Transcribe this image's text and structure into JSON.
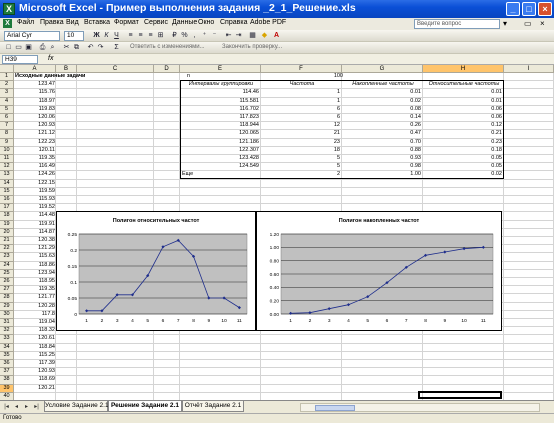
{
  "window": {
    "title": "Microsoft Excel - Пример выполнения задания _2_1_Решение.xls"
  },
  "menu": {
    "items": [
      "Файл",
      "Правка",
      "Вид",
      "Вставка",
      "Формат",
      "Сервис",
      "Данные",
      "Окно",
      "Справка",
      "Adobe PDF"
    ],
    "help_placeholder": "Введите вопрос"
  },
  "toolbar": {
    "font_name": "Arial Cyr",
    "font_size": "10",
    "currency_label": "%",
    "review_text_1": "Ответить с изменениями...",
    "review_text_2": "Закончить проверку..."
  },
  "formula_bar": {
    "name_box": "H39",
    "fx": "fx"
  },
  "columns": [
    "A",
    "B",
    "C",
    "D",
    "E",
    "F",
    "G",
    "H",
    "I"
  ],
  "selected_column": "H",
  "rows": [
    "1",
    "2",
    "3",
    "4",
    "5",
    "6",
    "7",
    "8",
    "9",
    "10",
    "11",
    "12",
    "13",
    "14",
    "15",
    "16",
    "17",
    "18",
    "19",
    "20",
    "21",
    "22",
    "23",
    "24",
    "25",
    "26",
    "27",
    "28",
    "29",
    "30",
    "31",
    "32",
    "33",
    "34",
    "35",
    "36",
    "37",
    "38",
    "39",
    "40"
  ],
  "col_a": {
    "header": "Исходные данные задачи",
    "values": [
      "123.47",
      "115.76",
      "118.97",
      "119.83",
      "120.06",
      "120.93",
      "121.12",
      "122.23",
      "120.11",
      "119.35",
      "116.49",
      "124.26",
      "122.15",
      "119.59",
      "115.93",
      "119.52",
      "114.48",
      "119.91",
      "114.87",
      "120.38",
      "121.29",
      "115.63",
      "118.86",
      "123.94",
      "118.95",
      "119.35",
      "121.77",
      "120.28",
      "117.8",
      "119.04",
      "118.32",
      "120.61",
      "118.84",
      "115.25",
      "117.39",
      "120.93",
      "118.69",
      "120.21"
    ]
  },
  "table": {
    "n_label": "n",
    "n_value": "100",
    "headers": [
      "Интервалы группировки",
      "Частота",
      "Накопленные частоты",
      "Относительные частоты"
    ],
    "rows": [
      [
        "114.46",
        "1",
        "0.01",
        "0.01"
      ],
      [
        "115.581",
        "1",
        "0.02",
        "0.01"
      ],
      [
        "116.702",
        "6",
        "0.08",
        "0.06"
      ],
      [
        "117.823",
        "6",
        "0.14",
        "0.06"
      ],
      [
        "118.944",
        "12",
        "0.26",
        "0.12"
      ],
      [
        "120.065",
        "21",
        "0.47",
        "0.21"
      ],
      [
        "121.186",
        "23",
        "0.70",
        "0.23"
      ],
      [
        "122.307",
        "18",
        "0.88",
        "0.18"
      ],
      [
        "123.428",
        "5",
        "0.93",
        "0.05"
      ],
      [
        "124.549",
        "5",
        "0.98",
        "0.05"
      ],
      [
        "Еще",
        "2",
        "1.00",
        "0.02"
      ]
    ]
  },
  "chart_data": [
    {
      "type": "line",
      "title": "Полигон относительных частот",
      "x": [
        "1",
        "2",
        "3",
        "4",
        "5",
        "6",
        "7",
        "8",
        "9",
        "10",
        "11"
      ],
      "values": [
        0.01,
        0.01,
        0.06,
        0.06,
        0.12,
        0.21,
        0.23,
        0.18,
        0.05,
        0.05,
        0.02
      ],
      "ylim": [
        0,
        0.25
      ],
      "yticks": [
        "0",
        "0.05",
        "0.1",
        "0.15",
        "0.2",
        "0.25"
      ],
      "grid": true,
      "plot_bg": "#c0c0c0",
      "line_color": "#1f2e8c"
    },
    {
      "type": "line",
      "title": "Полигон накопленных частот",
      "x": [
        "1",
        "2",
        "3",
        "4",
        "5",
        "6",
        "7",
        "8",
        "9",
        "10",
        "11"
      ],
      "values": [
        0.01,
        0.02,
        0.08,
        0.14,
        0.26,
        0.47,
        0.7,
        0.88,
        0.93,
        0.98,
        1.0
      ],
      "ylim": [
        0,
        1.2
      ],
      "yticks": [
        "0.00",
        "0.20",
        "0.40",
        "0.60",
        "0.80",
        "1.00",
        "1.20"
      ],
      "grid": true,
      "plot_bg": "#c0c0c0",
      "line_color": "#1f2e8c"
    }
  ],
  "sheet_tabs": [
    "Условие Задание 2.1",
    "Решение Задание 2.1",
    "Отчёт Задание 2.1"
  ],
  "active_tab": 1,
  "status": "Готово"
}
